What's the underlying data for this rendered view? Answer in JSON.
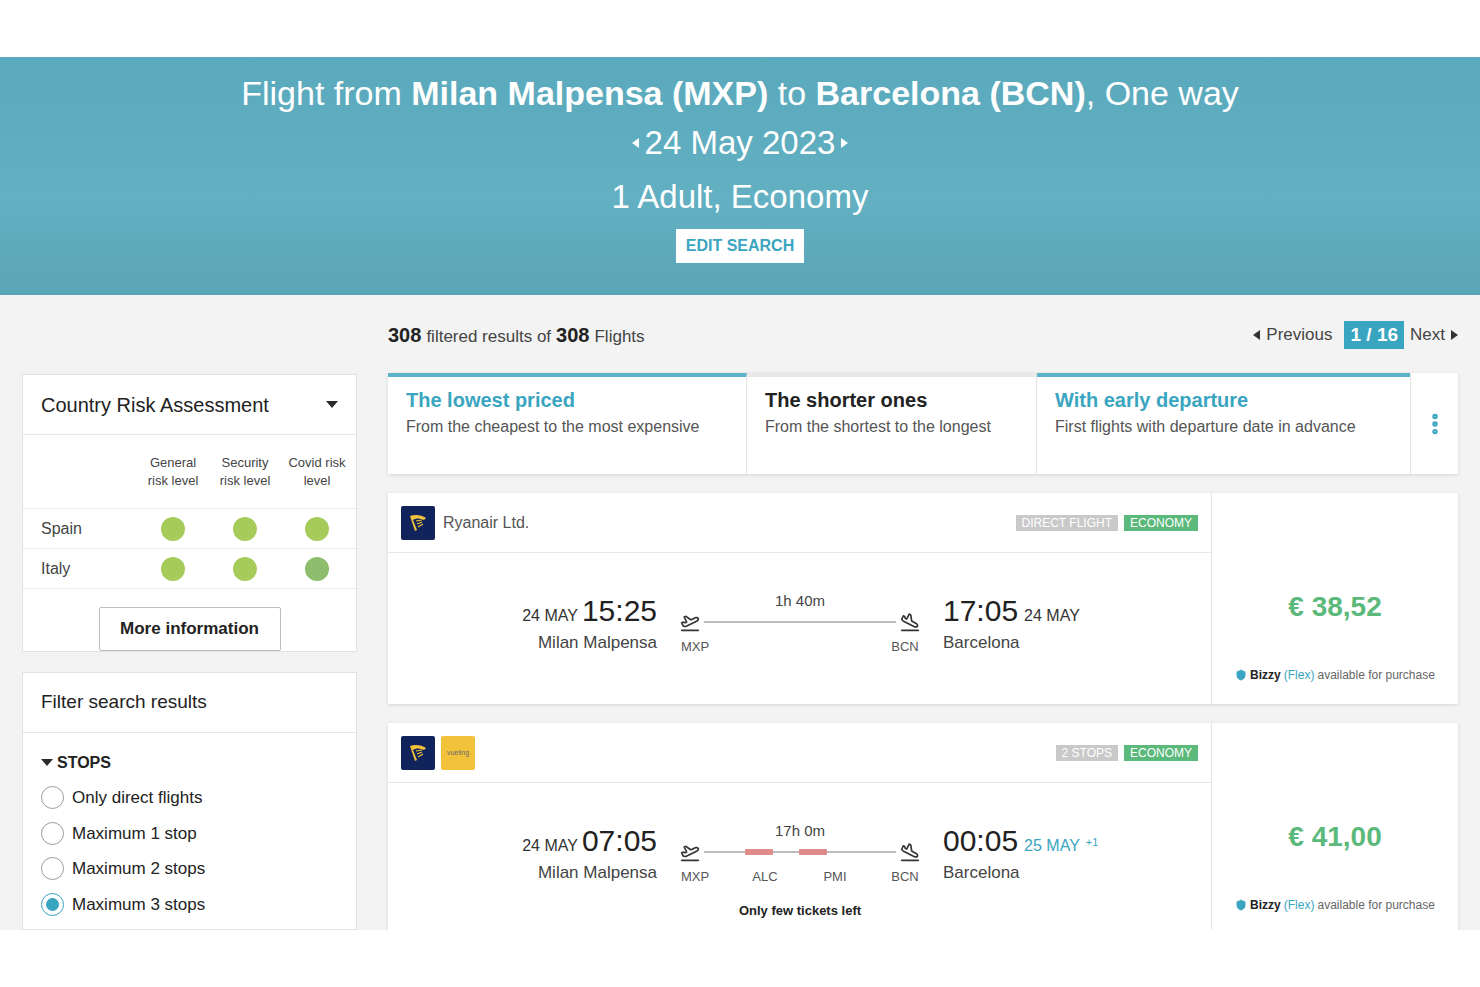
{
  "header": {
    "title_prefix": "Flight from",
    "origin": "Milan Malpensa (MXP)",
    "connector": "to",
    "destination": "Barcelona (BCN)",
    "trip_type": ", One way",
    "date": "24 May 2023",
    "passengers": "1 Adult, Economy",
    "edit_button": "EDIT SEARCH"
  },
  "results": {
    "filtered_count": "308",
    "filtered_label": "filtered results of",
    "total_count": "308",
    "total_label": "Flights",
    "previous": "Previous",
    "page": "1 / 16",
    "next": "Next"
  },
  "sort_tabs": [
    {
      "title": "The lowest priced",
      "subtitle": "From the cheapest to the most expensive",
      "highlighted": true
    },
    {
      "title": "The shorter ones",
      "subtitle": "From the shortest to the longest",
      "highlighted": false
    },
    {
      "title": "With early departure",
      "subtitle": "First flights with departure date in advance",
      "highlighted": true
    }
  ],
  "risk_panel": {
    "title": "Country Risk Assessment",
    "expanded": true,
    "columns": [
      "General risk level",
      "Security risk level",
      "Covid risk level"
    ],
    "rows": [
      {
        "country": "Spain",
        "levels": [
          {
            "color": "#a6cb5b"
          },
          {
            "color": "#a6cb5b"
          },
          {
            "color": "#a6cb5b"
          }
        ]
      },
      {
        "country": "Italy",
        "levels": [
          {
            "color": "#a6cb5b"
          },
          {
            "color": "#a6cb5b"
          },
          {
            "color": "#8dbd6d"
          }
        ]
      }
    ],
    "button": "More information"
  },
  "filter_panel": {
    "title": "Filter search results",
    "section": "STOPS",
    "expanded": true,
    "options": [
      {
        "label": "Only direct flights",
        "selected": false
      },
      {
        "label": "Maximum 1 stop",
        "selected": false
      },
      {
        "label": "Maximum 2 stops",
        "selected": false
      },
      {
        "label": "Maximum 3 stops",
        "selected": true
      }
    ]
  },
  "flights": [
    {
      "airlines": [
        {
          "kind": "ryanair",
          "logo_text": ""
        }
      ],
      "airline_name": "Ryanair Ltd.",
      "tags": [
        {
          "label": "DIRECT FLIGHT",
          "color": "#c9c9c9"
        },
        {
          "label": "ECONOMY",
          "color": "#5bb97b"
        }
      ],
      "depart_date": "24 MAY",
      "depart_time": "15:25",
      "depart_city": "Milan Malpensa",
      "duration": "1h 40m",
      "airports": [
        "MXP",
        "BCN"
      ],
      "arrive_time": "17:05",
      "arrive_date": "24 MAY",
      "day_offset": "",
      "arrive_city": "Barcelona",
      "note": "",
      "price": "€ 38,52",
      "flex": {
        "brand": "Bizzy",
        "flex": "(Flex)",
        "text": "available for purchase"
      }
    },
    {
      "airlines": [
        {
          "kind": "ryanair",
          "logo_text": ""
        },
        {
          "kind": "vueling",
          "logo_text": "vueling"
        }
      ],
      "airline_name": "",
      "tags": [
        {
          "label": "2 STOPS",
          "color": "#c9c9c9"
        },
        {
          "label": "ECONOMY",
          "color": "#5bb97b"
        }
      ],
      "depart_date": "24 MAY",
      "depart_time": "07:05",
      "depart_city": "Milan Malpensa",
      "duration": "17h 0m",
      "airports": [
        "MXP",
        "ALC",
        "PMI",
        "BCN"
      ],
      "arrive_time": "00:05",
      "arrive_date": "25 MAY",
      "day_offset": "+1",
      "arrive_city": "Barcelona",
      "note": "Only few tickets left",
      "price": "€ 41,00",
      "flex": {
        "brand": "Bizzy",
        "flex": "(Flex)",
        "text": "available for purchase"
      }
    }
  ]
}
